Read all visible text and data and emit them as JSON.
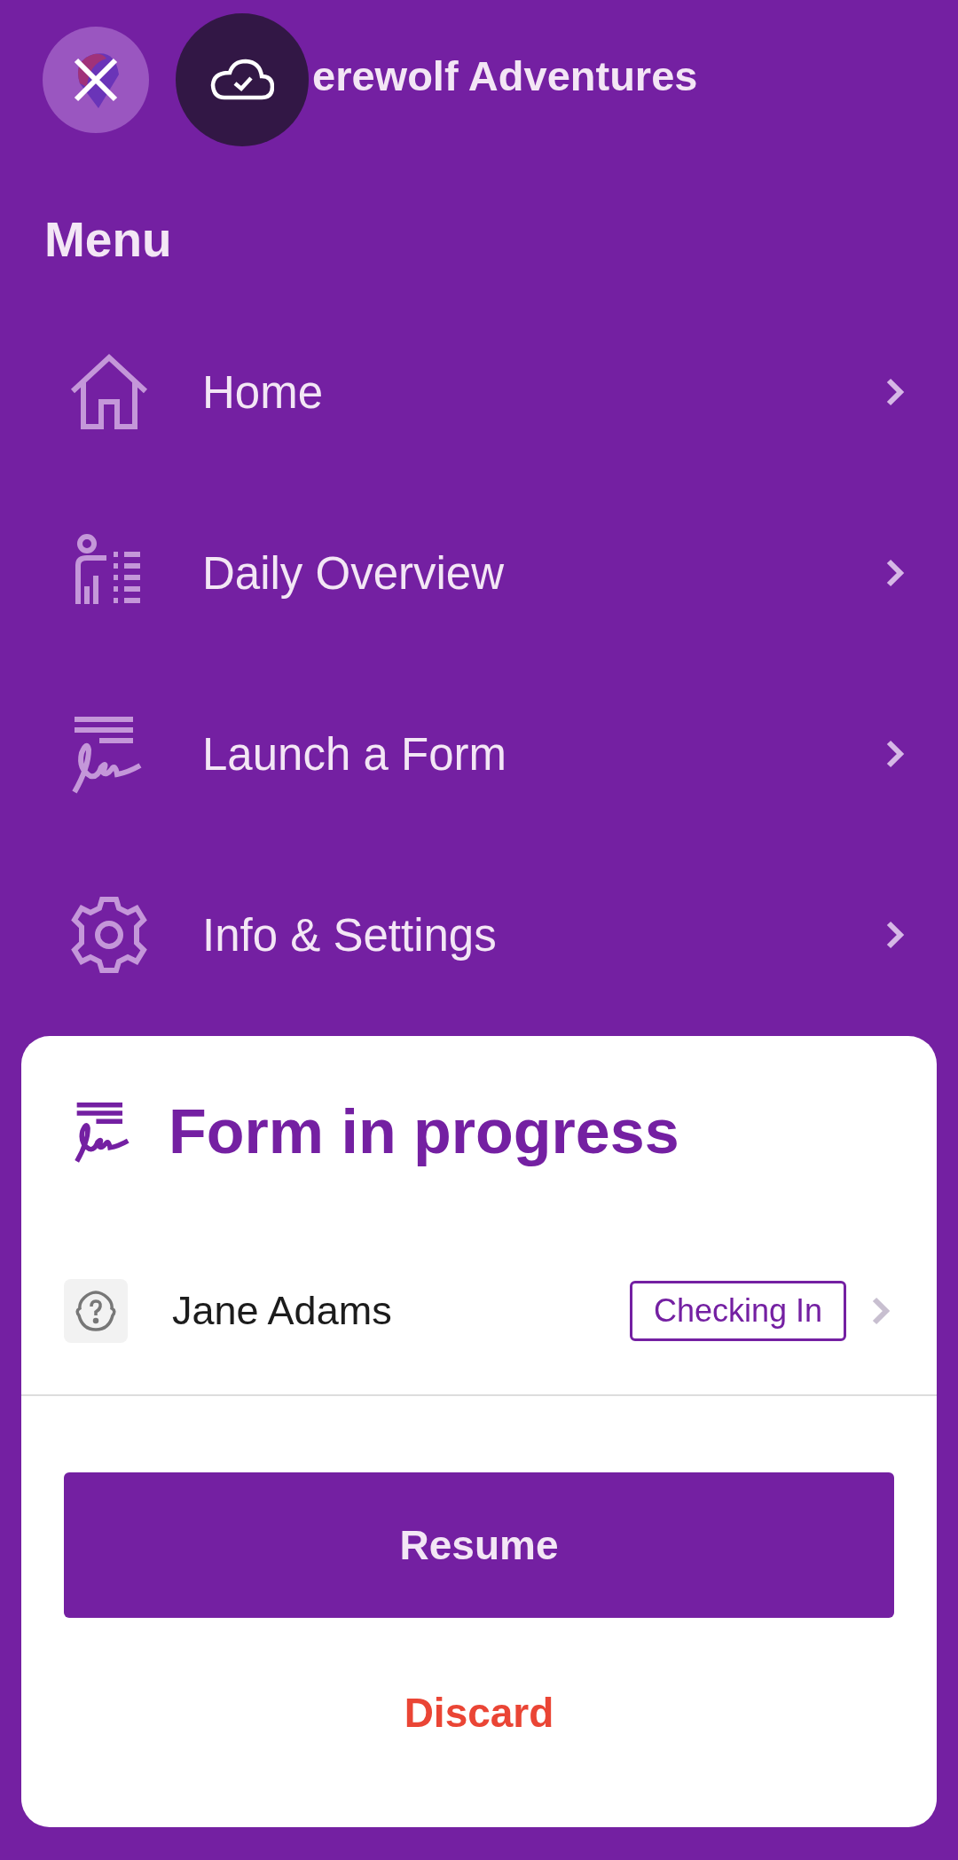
{
  "header": {
    "title": "erewolf Adventures"
  },
  "menu": {
    "heading": "Menu",
    "items": [
      {
        "label": "Home",
        "kind": "home"
      },
      {
        "label": "Daily Overview",
        "kind": "overview"
      },
      {
        "label": "Launch a Form",
        "kind": "form"
      },
      {
        "label": "Info & Settings",
        "kind": "settings"
      }
    ]
  },
  "form_in_progress": {
    "title": "Form in progress",
    "entry": {
      "name": "Jane Adams",
      "status": "Checking In"
    },
    "buttons": [
      {
        "label": "Resume",
        "kind": "primary"
      },
      {
        "label": "Discard",
        "kind": "danger"
      }
    ]
  }
}
